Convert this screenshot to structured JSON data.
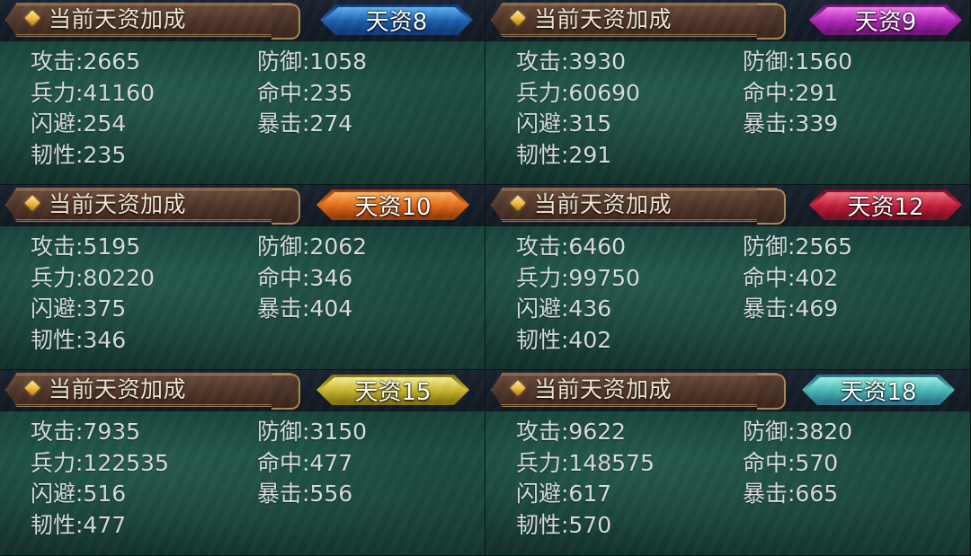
{
  "header_title": "当前天资加成",
  "panels": [
    {
      "badge": "天资8",
      "badge_colors": [
        "#5fb3f2",
        "#1d5fae",
        "#0f3a78"
      ],
      "stats": [
        "攻击:2665",
        "防御:1058",
        "兵力:41160",
        "命中:235",
        "闪避:254",
        "暴击:274",
        "韧性:235"
      ]
    },
    {
      "badge": "天资9",
      "badge_colors": [
        "#f37ef0",
        "#b227b9",
        "#6e1176"
      ],
      "stats": [
        "攻击:3930",
        "防御:1560",
        "兵力:60690",
        "命中:291",
        "闪避:315",
        "暴击:339",
        "韧性:291"
      ]
    },
    {
      "badge": "天资10",
      "badge_colors": [
        "#ffb562",
        "#e06a1a",
        "#8f3a0a"
      ],
      "stats": [
        "攻击:5195",
        "防御:2062",
        "兵力:80220",
        "命中:346",
        "闪避:375",
        "暴击:404",
        "韧性:346"
      ]
    },
    {
      "badge": "天资12",
      "badge_colors": [
        "#f2707f",
        "#c21d3a",
        "#7a0d22"
      ],
      "stats": [
        "攻击:6460",
        "防御:2565",
        "兵力:99750",
        "命中:402",
        "闪避:436",
        "暴击:469",
        "韧性:402"
      ]
    },
    {
      "badge": "天资15",
      "badge_colors": [
        "#f4f09a",
        "#c7b52b",
        "#7e6e10"
      ],
      "stats": [
        "攻击:7935",
        "防御:3150",
        "兵力:122535",
        "命中:477",
        "闪避:516",
        "暴击:556",
        "韧性:477"
      ]
    },
    {
      "badge": "天资18",
      "badge_colors": [
        "#9ff3e3",
        "#46b8b4",
        "#2a6f8a"
      ],
      "stats": [
        "攻击:9622",
        "防御:3820",
        "兵力:148575",
        "命中:570",
        "闪避:617",
        "暴击:665",
        "韧性:570"
      ]
    }
  ]
}
